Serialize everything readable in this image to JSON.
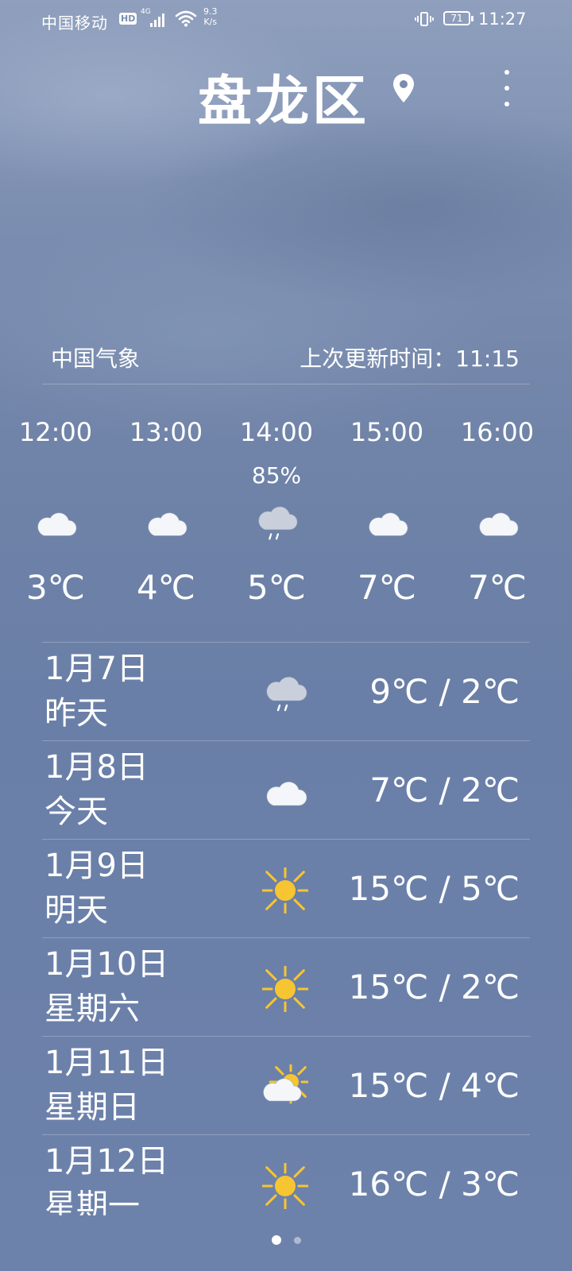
{
  "status_bar": {
    "carrier": "中国移动",
    "hd_badge": "HD",
    "network_type": "4G",
    "speed_value": "9.3",
    "speed_unit": "K/s",
    "battery_level": "71",
    "time": "11:27"
  },
  "header": {
    "city": "盘龙区"
  },
  "source": {
    "provider": "中国气象",
    "update_label": "上次更新时间：11:15"
  },
  "hourly": [
    {
      "time": "12:00",
      "precip": "",
      "icon": "cloud-icon",
      "temp": "3℃"
    },
    {
      "time": "13:00",
      "precip": "",
      "icon": "cloud-icon",
      "temp": "4℃"
    },
    {
      "time": "14:00",
      "precip": "85%",
      "icon": "rain-cloud-icon",
      "temp": "5℃"
    },
    {
      "time": "15:00",
      "precip": "",
      "icon": "cloud-icon",
      "temp": "7℃"
    },
    {
      "time": "16:00",
      "precip": "",
      "icon": "cloud-icon",
      "temp": "7℃"
    }
  ],
  "daily": [
    {
      "date": "1月7日",
      "label": "昨天",
      "icon": "rain-cloud-icon",
      "temp": "9℃ / 2℃"
    },
    {
      "date": "1月8日",
      "label": "今天",
      "icon": "cloud-icon",
      "temp": "7℃ / 2℃"
    },
    {
      "date": "1月9日",
      "label": "明天",
      "icon": "sun-icon",
      "temp": "15℃ / 5℃"
    },
    {
      "date": "1月10日",
      "label": "星期六",
      "icon": "sun-icon",
      "temp": "15℃ / 2℃"
    },
    {
      "date": "1月11日",
      "label": "星期日",
      "icon": "partly-cloudy-icon",
      "temp": "15℃ / 4℃"
    },
    {
      "date": "1月12日",
      "label": "星期一",
      "icon": "sun-icon",
      "temp": "16℃ / 3℃"
    }
  ],
  "pager": {
    "pages": 2,
    "active": 1
  },
  "colors": {
    "sky_top": "#8f9fbd",
    "sky_bottom": "#6d82ab",
    "sun": "#f7c531",
    "cloud": "#f4f6f9",
    "rain_cloud": "#c9d0dc"
  }
}
